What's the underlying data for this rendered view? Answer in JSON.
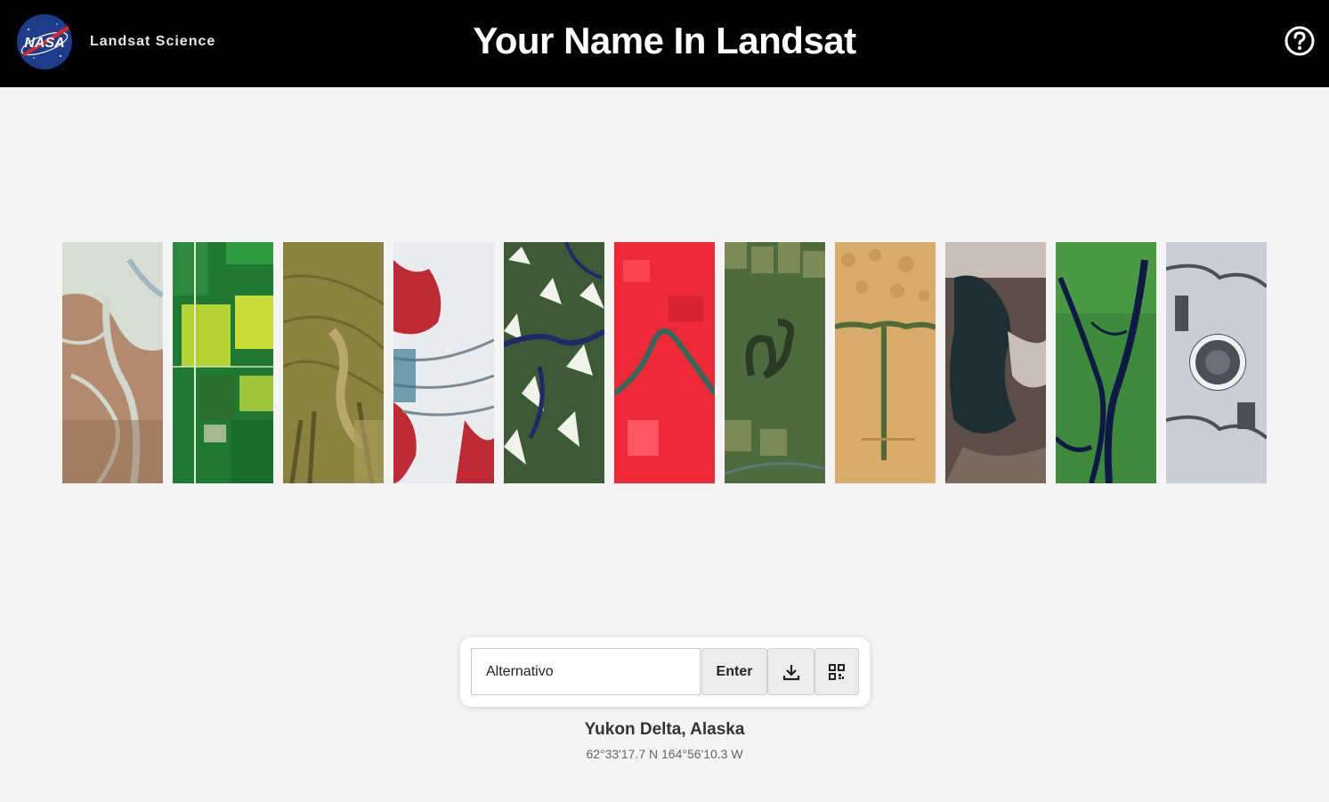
{
  "header": {
    "brand": "Landsat Science",
    "logo_text": "NASA",
    "title": "Your Name In Landsat",
    "help_icon": "help-circle-icon"
  },
  "letters": [
    {
      "id": "A",
      "theme": "yukon-delta",
      "colors": [
        "#cfd8cd",
        "#b48a6e",
        "#8f6f55"
      ]
    },
    {
      "id": "L",
      "theme": "green-fields",
      "colors": [
        "#1e7a33",
        "#b6d334",
        "#2f8f3a"
      ]
    },
    {
      "id": "T",
      "theme": "olive-terrain",
      "colors": [
        "#8a8340",
        "#6e6a2d",
        "#a89b5a"
      ]
    },
    {
      "id": "E",
      "theme": "glacier-red",
      "colors": [
        "#e8ecee",
        "#c02a34",
        "#7a8a94"
      ]
    },
    {
      "id": "R",
      "theme": "mountain-river",
      "colors": [
        "#3c5b34",
        "#f2f2ec",
        "#1c2a6b"
      ]
    },
    {
      "id": "N",
      "theme": "red-fields-river",
      "colors": [
        "#ef2a36",
        "#ff4c56",
        "#2f6a5e"
      ]
    },
    {
      "id": "A",
      "theme": "oxbow-fields",
      "colors": [
        "#4e6b3e",
        "#7c8a55",
        "#2a3a25"
      ]
    },
    {
      "id": "T",
      "theme": "desert-dunes",
      "colors": [
        "#d9ac6a",
        "#c89a55",
        "#4f6b3a"
      ]
    },
    {
      "id": "I",
      "theme": "dark-lake",
      "colors": [
        "#1d2f33",
        "#c9bfb7",
        "#5a4e46"
      ]
    },
    {
      "id": "V",
      "theme": "river-delta-green",
      "colors": [
        "#3d8a3a",
        "#101848",
        "#63a24c"
      ]
    },
    {
      "id": "O",
      "theme": "crater-snow",
      "colors": [
        "#c9ced4",
        "#4a4f57",
        "#eef0f2"
      ]
    }
  ],
  "search": {
    "value": "Alternativo",
    "enter_label": "Enter",
    "download_icon": "download-icon",
    "qr_icon": "qr-code-icon"
  },
  "location": {
    "name": "Yukon Delta, Alaska",
    "coords": "62°33'17.7 N 164°56'10.3 W"
  }
}
